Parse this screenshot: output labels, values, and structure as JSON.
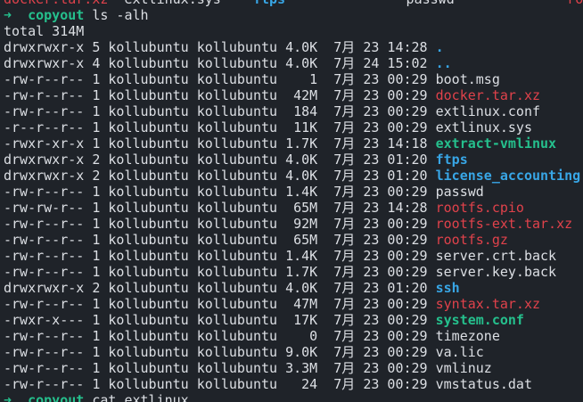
{
  "window": {
    "title": ""
  },
  "colors": {
    "background": "#1f2329",
    "foreground": "#dcdfe4",
    "red": "#e0424b",
    "green": "#25c08d",
    "blue": "#38a6e6"
  },
  "lines": [
    {
      "segs": [
        {
          "t": "docker.tar.xz",
          "c": "red"
        },
        {
          "t": "  extlinux.sys    ",
          "c": "default"
        },
        {
          "t": "ftps",
          "c": "blue"
        },
        {
          "t": "               passwd              ",
          "c": "default"
        },
        {
          "t": "rootf",
          "c": "red"
        }
      ]
    },
    {
      "segs": [
        {
          "t": "➜  ",
          "c": "arrow"
        },
        {
          "t": "copyout",
          "c": "prompt"
        },
        {
          "t": " ls -alh",
          "c": "default"
        }
      ]
    },
    {
      "segs": [
        {
          "t": "total 314M",
          "c": "default"
        }
      ]
    },
    {
      "segs": [
        {
          "t": "drwxrwxr-x 5 kollubuntu kollubuntu 4.0K  7月 23 14:28 ",
          "c": "default"
        },
        {
          "t": ".",
          "c": "blue-dir"
        }
      ]
    },
    {
      "segs": [
        {
          "t": "drwxrwxr-x 4 kollubuntu kollubuntu 4.0K  7月 24 15:02 ",
          "c": "default"
        },
        {
          "t": "..",
          "c": "blue-dir"
        }
      ]
    },
    {
      "segs": [
        {
          "t": "-rw-r--r-- 1 kollubuntu kollubuntu    1  7月 23 00:29 boot.msg",
          "c": "default"
        }
      ]
    },
    {
      "segs": [
        {
          "t": "-rw-r--r-- 1 kollubuntu kollubuntu  42M  7月 23 00:29 ",
          "c": "default"
        },
        {
          "t": "docker.tar.xz",
          "c": "red"
        }
      ]
    },
    {
      "segs": [
        {
          "t": "-rw-r--r-- 1 kollubuntu kollubuntu  184  7月 23 00:29 extlinux.conf",
          "c": "default"
        }
      ]
    },
    {
      "segs": [
        {
          "t": "-r--r--r-- 1 kollubuntu kollubuntu  11K  7月 23 00:29 extlinux.sys",
          "c": "default"
        }
      ]
    },
    {
      "segs": [
        {
          "t": "-rwxr-xr-x 1 kollubuntu kollubuntu 1.7K  7月 23 14:18 ",
          "c": "default"
        },
        {
          "t": "extract-vmlinux",
          "c": "green"
        }
      ]
    },
    {
      "segs": [
        {
          "t": "drwxrwxr-x 2 kollubuntu kollubuntu 4.0K  7月 23 01:20 ",
          "c": "default"
        },
        {
          "t": "ftps",
          "c": "blue-dir"
        }
      ]
    },
    {
      "segs": [
        {
          "t": "drwxrwxr-x 2 kollubuntu kollubuntu 4.0K  7月 23 01:20 ",
          "c": "default"
        },
        {
          "t": "license_accounting",
          "c": "blue-dir"
        }
      ]
    },
    {
      "segs": [
        {
          "t": "-rw-r--r-- 1 kollubuntu kollubuntu 1.4K  7月 23 00:29 passwd",
          "c": "default"
        }
      ]
    },
    {
      "segs": [
        {
          "t": "-rw-rw-r-- 1 kollubuntu kollubuntu  65M  7月 23 14:28 ",
          "c": "default"
        },
        {
          "t": "rootfs.cpio",
          "c": "red"
        }
      ]
    },
    {
      "segs": [
        {
          "t": "-rw-r--r-- 1 kollubuntu kollubuntu  92M  7月 23 00:29 ",
          "c": "default"
        },
        {
          "t": "rootfs-ext.tar.xz",
          "c": "red"
        }
      ]
    },
    {
      "segs": [
        {
          "t": "-rw-r--r-- 1 kollubuntu kollubuntu  65M  7月 23 00:29 ",
          "c": "default"
        },
        {
          "t": "rootfs.gz",
          "c": "red"
        }
      ]
    },
    {
      "segs": [
        {
          "t": "-rw-r--r-- 1 kollubuntu kollubuntu 1.4K  7月 23 00:29 server.crt.back",
          "c": "default"
        }
      ]
    },
    {
      "segs": [
        {
          "t": "-rw-r--r-- 1 kollubuntu kollubuntu 1.7K  7月 23 00:29 server.key.back",
          "c": "default"
        }
      ]
    },
    {
      "segs": [
        {
          "t": "drwxrwxr-x 2 kollubuntu kollubuntu 4.0K  7月 23 01:20 ",
          "c": "default"
        },
        {
          "t": "ssh",
          "c": "blue-dir"
        }
      ]
    },
    {
      "segs": [
        {
          "t": "-rw-r--r-- 1 kollubuntu kollubuntu  47M  7月 23 00:29 ",
          "c": "default"
        },
        {
          "t": "syntax.tar.xz",
          "c": "red"
        }
      ]
    },
    {
      "segs": [
        {
          "t": "-rwxr-x--- 1 kollubuntu kollubuntu  17K  7月 23 00:29 ",
          "c": "default"
        },
        {
          "t": "system.conf",
          "c": "green"
        }
      ]
    },
    {
      "segs": [
        {
          "t": "-rw-r--r-- 1 kollubuntu kollubuntu    0  7月 23 00:29 timezone",
          "c": "default"
        }
      ]
    },
    {
      "segs": [
        {
          "t": "-rw-r--r-- 1 kollubuntu kollubuntu 9.0K  7月 23 00:29 va.lic",
          "c": "default"
        }
      ]
    },
    {
      "segs": [
        {
          "t": "-rw-r--r-- 1 kollubuntu kollubuntu 3.3M  7月 23 00:29 vmlinuz",
          "c": "default"
        }
      ]
    },
    {
      "segs": [
        {
          "t": "-rw-r--r-- 1 kollubuntu kollubuntu   24  7月 23 00:29 vmstatus.dat",
          "c": "default"
        }
      ]
    },
    {
      "segs": [
        {
          "t": "➜  ",
          "c": "arrow"
        },
        {
          "t": "copyout",
          "c": "prompt"
        },
        {
          "t": " cat extlinux.",
          "c": "default"
        }
      ]
    }
  ]
}
